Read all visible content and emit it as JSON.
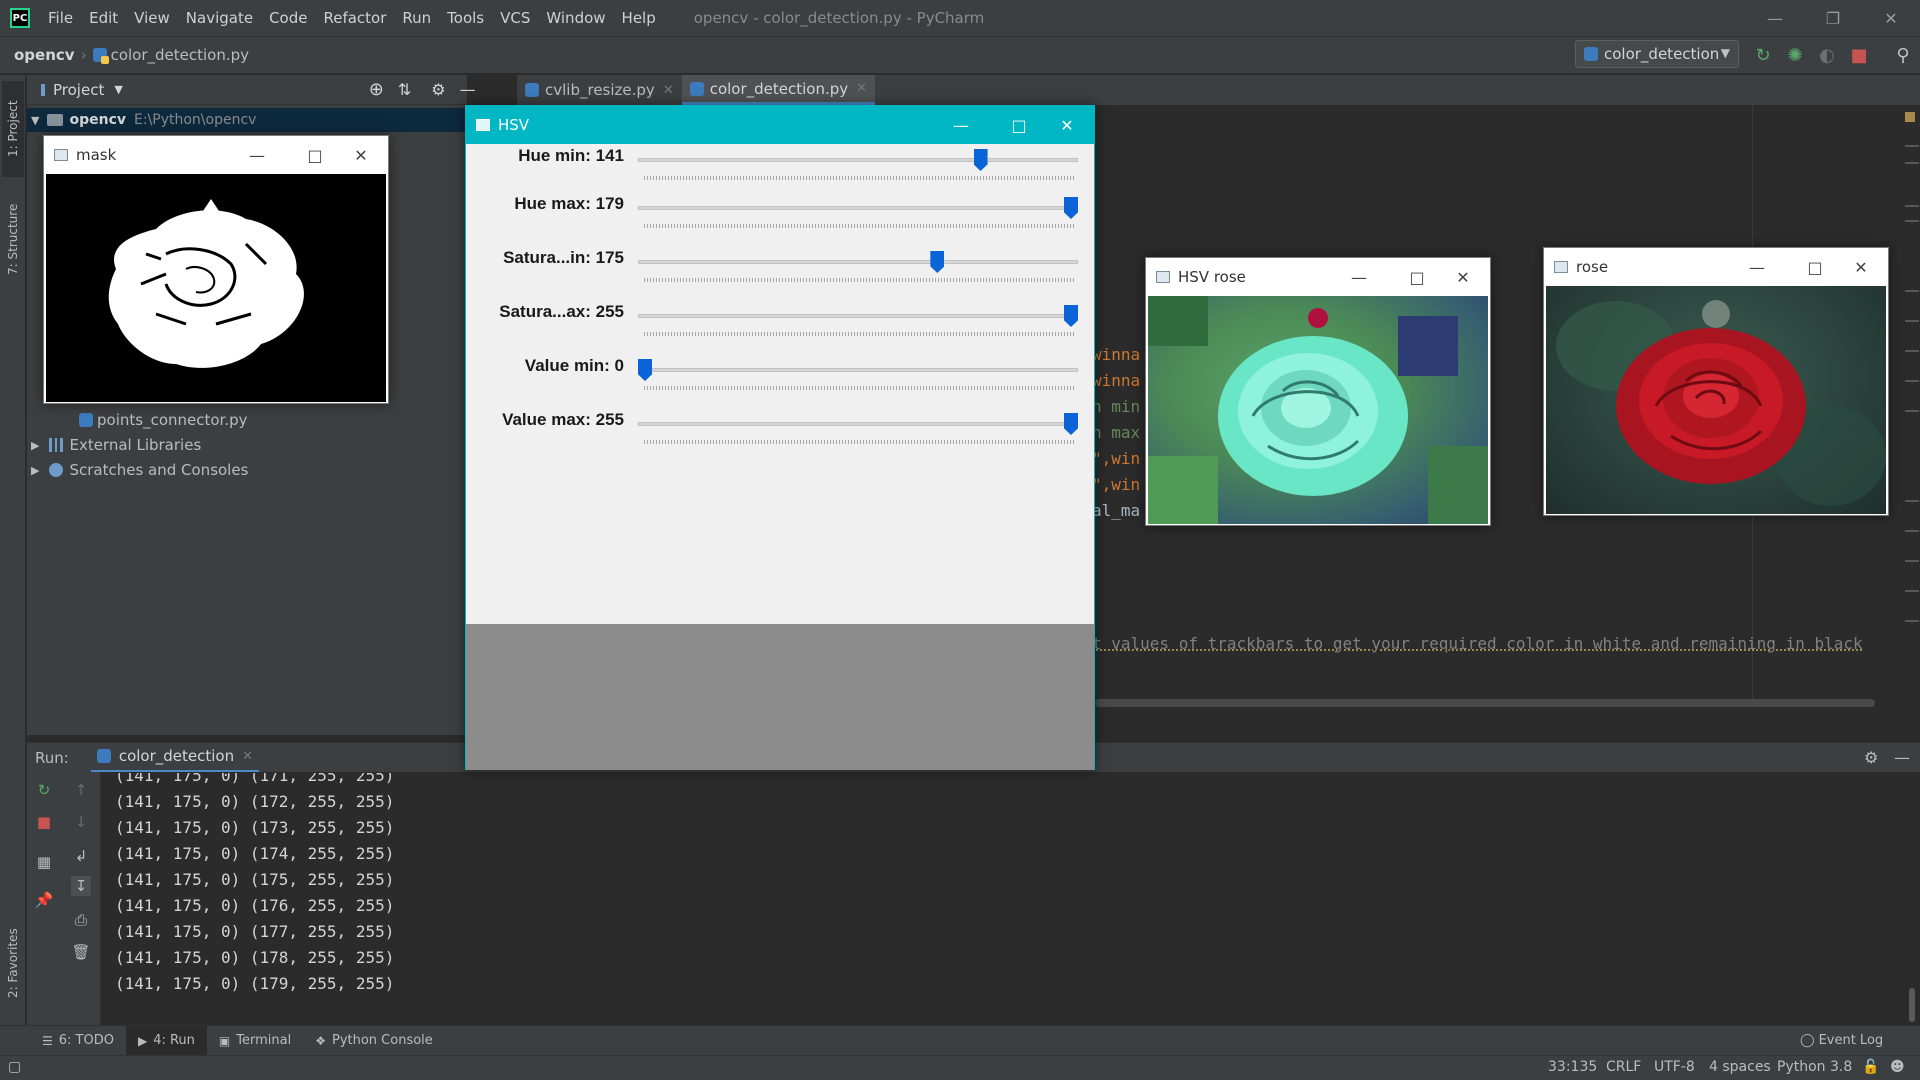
{
  "menubar": {
    "logo": "PC",
    "items": [
      {
        "label": "File"
      },
      {
        "label": "Edit"
      },
      {
        "label": "View"
      },
      {
        "label": "Navigate"
      },
      {
        "label": "Code"
      },
      {
        "label": "Refactor"
      },
      {
        "label": "Run"
      },
      {
        "label": "Tools"
      },
      {
        "label": "VCS"
      },
      {
        "label": "Window"
      },
      {
        "label": "Help"
      }
    ],
    "window_title": "opencv - color_detection.py - PyCharm"
  },
  "navbar": {
    "project": "opencv",
    "file": "color_detection.py",
    "run_config": "color_detection"
  },
  "left_strip": {
    "project_tab": "1: Project",
    "structure_tab": "7: Structure",
    "favorites_tab": "2: Favorites"
  },
  "project_panel": {
    "title": "Project",
    "root_name": "opencv",
    "root_path": "E:\\Python\\opencv",
    "items": [
      {
        "label": "points_connector.py"
      },
      {
        "label": "External Libraries"
      },
      {
        "label": "Scratches and Consoles"
      }
    ]
  },
  "editor_tabs": [
    {
      "label": "cvlib_resize.py"
    },
    {
      "label": "color_detection.py"
    }
  ],
  "editor_fragments": {
    "l1": "winna",
    "l2": "winna",
    "l3": "n min",
    "l4": "n max",
    "l5": "\",win",
    "l6": "\",win",
    "l7": "al_ma",
    "comment": "t values of trackbars to get your required color in white and remaining in black"
  },
  "hsv_window": {
    "title": "HSV",
    "trackbars": [
      {
        "label": "Hue min: 141",
        "value": 141,
        "max": 179
      },
      {
        "label": "Hue max: 179",
        "value": 179,
        "max": 179
      },
      {
        "label": "Satura...in: 175",
        "value": 175,
        "max": 255
      },
      {
        "label": "Satura...ax: 255",
        "value": 255,
        "max": 255
      },
      {
        "label": "Value min: 0",
        "value": 0,
        "max": 255
      },
      {
        "label": "Value max: 255",
        "value": 255,
        "max": 255
      }
    ]
  },
  "mask_window": {
    "title": "mask"
  },
  "hsv_rose_window": {
    "title": "HSV rose"
  },
  "rose_window": {
    "title": "rose"
  },
  "run_panel": {
    "label": "Run:",
    "tab": "color_detection",
    "lines": [
      "(141, 175, 0) (171, 255, 255)",
      "(141, 175, 0) (172, 255, 255)",
      "(141, 175, 0) (173, 255, 255)",
      "(141, 175, 0) (174, 255, 255)",
      "(141, 175, 0) (175, 255, 255)",
      "(141, 175, 0) (176, 255, 255)",
      "(141, 175, 0) (177, 255, 255)",
      "(141, 175, 0) (178, 255, 255)",
      "(141, 175, 0) (179, 255, 255)"
    ]
  },
  "bottom_tabs": [
    {
      "label": "6: TODO"
    },
    {
      "label": "4: Run"
    },
    {
      "label": "Terminal"
    },
    {
      "label": "Python Console"
    }
  ],
  "event_log": "Event Log",
  "status": {
    "position": "33:135",
    "line_sep": "CRLF",
    "encoding": "UTF-8",
    "indent": "4 spaces",
    "interpreter": "Python 3.8"
  },
  "colors": {
    "accent": "#00b7c3",
    "thumb": "#0a64d8",
    "code_orange": "#cc7832",
    "code_green": "#6a8759"
  }
}
